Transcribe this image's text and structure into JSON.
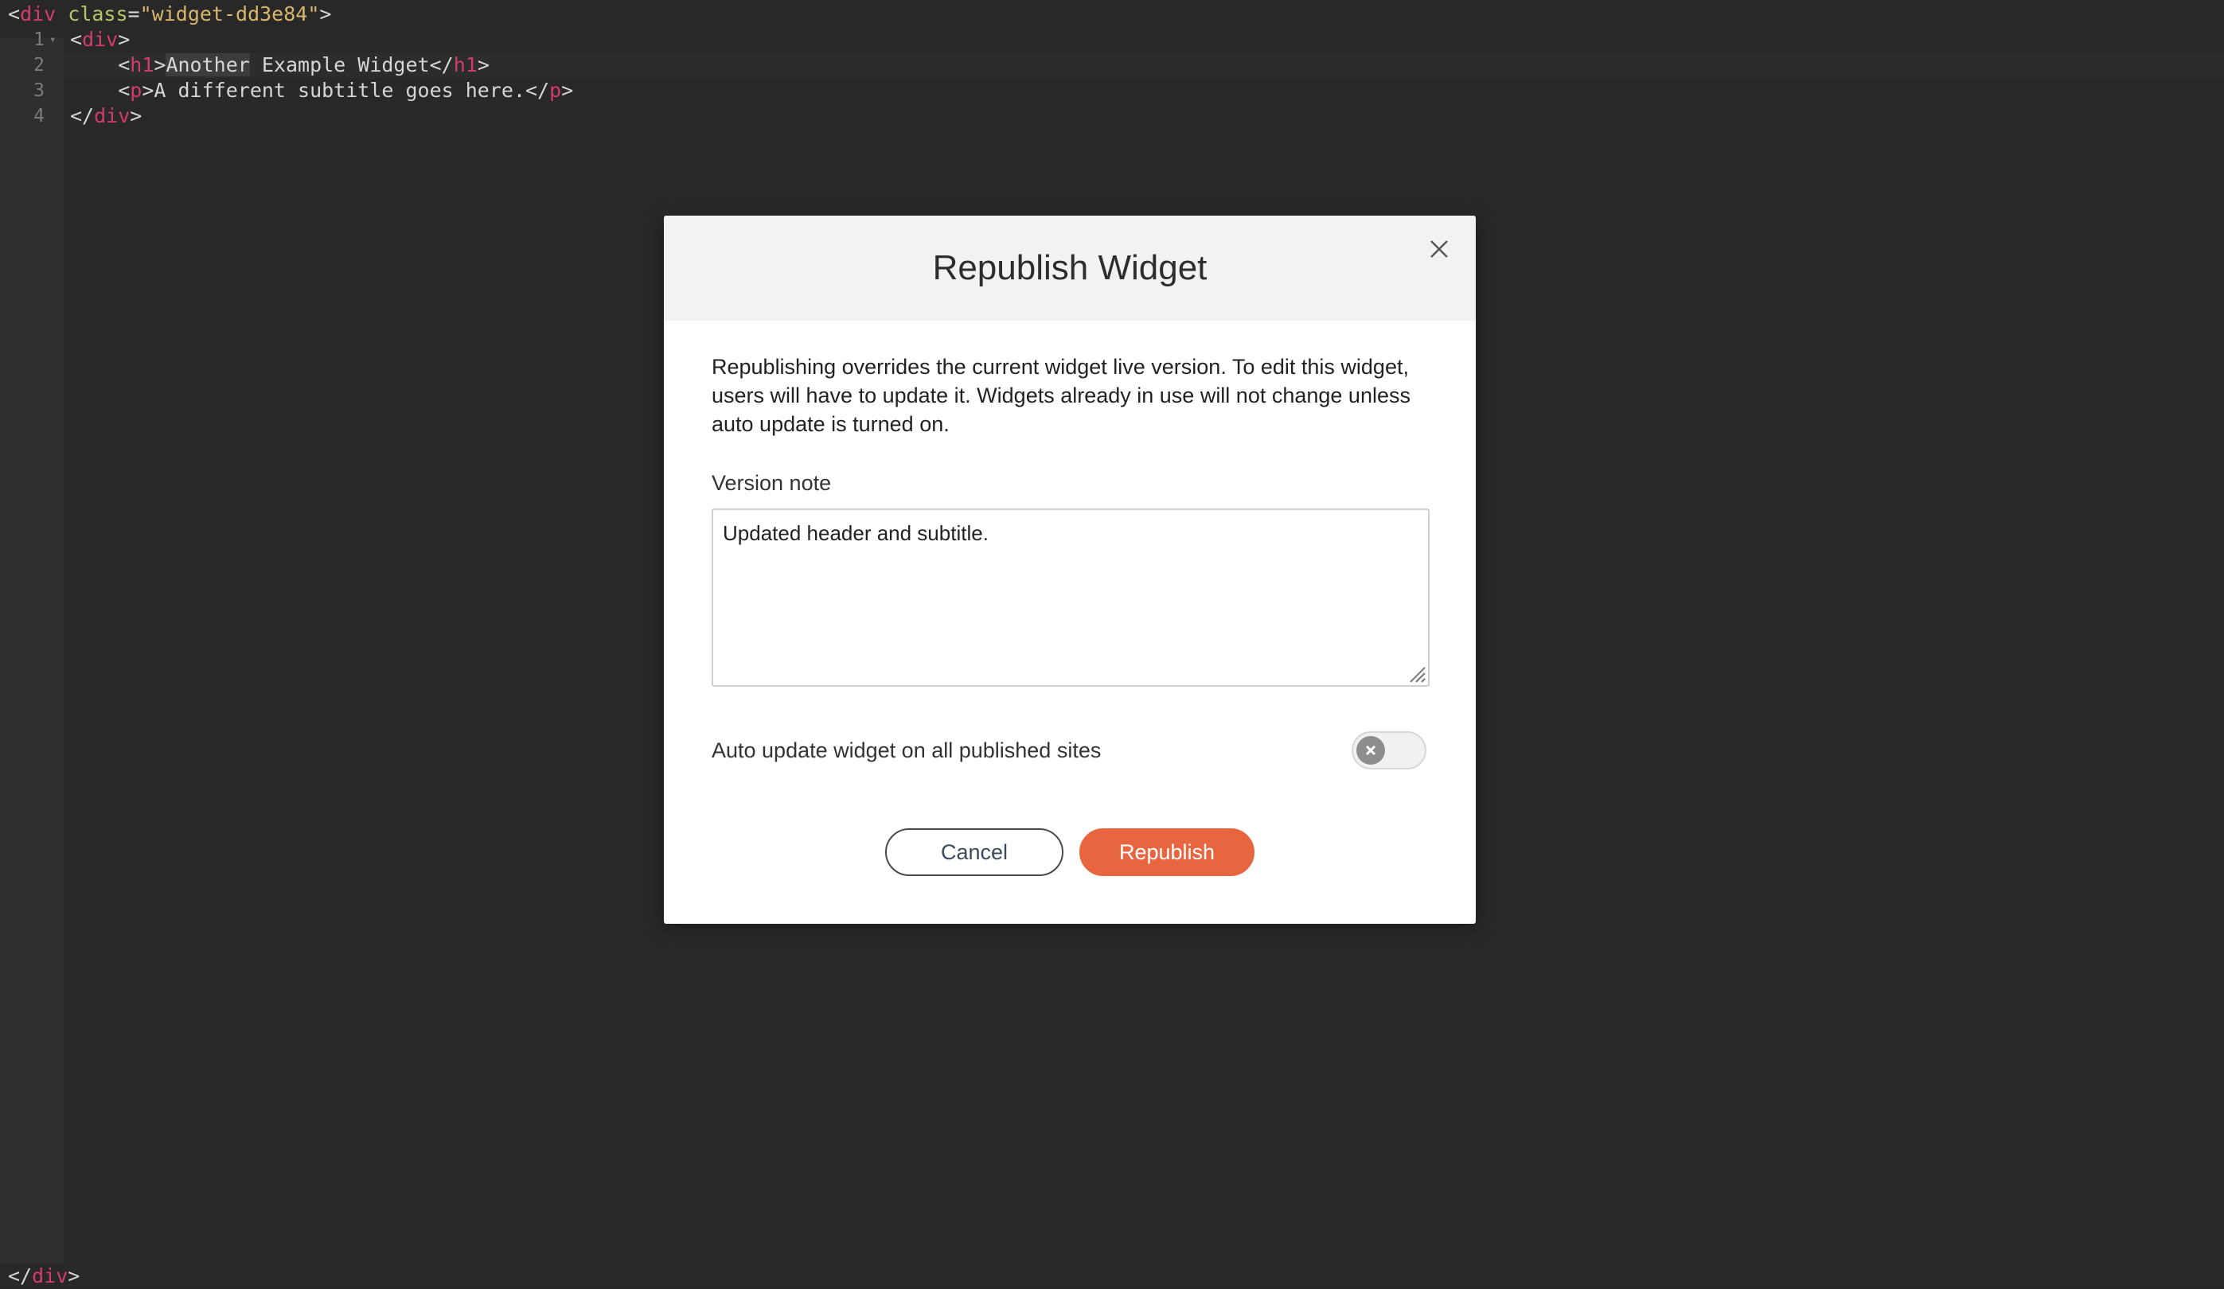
{
  "editor": {
    "wrapper_open": "<div class=\"widget-dd3e84\">",
    "wrapper_open_parts": {
      "lt": "<",
      "tag": "div",
      "attr": "class",
      "eq": "=",
      "str": "\"widget-dd3e84\"",
      "gt": ">"
    },
    "lines": [
      {
        "num": "1",
        "indent": "",
        "open_lt": "<",
        "open_tag": "div",
        "open_gt": ">",
        "text": "",
        "close_lt": "",
        "close_tag": "",
        "close_gt": ""
      },
      {
        "num": "2",
        "indent": "    ",
        "open_lt": "<",
        "open_tag": "h1",
        "open_gt": ">",
        "text_hl": "Another",
        "text": " Example Widget",
        "close_lt": "</",
        "close_tag": "h1",
        "close_gt": ">"
      },
      {
        "num": "3",
        "indent": "    ",
        "open_lt": "<",
        "open_tag": "p",
        "open_gt": ">",
        "text": "A different subtitle goes here.",
        "close_lt": "</",
        "close_tag": "p",
        "close_gt": ">"
      },
      {
        "num": "4",
        "indent": "",
        "open_lt": "</",
        "open_tag": "div",
        "open_gt": ">",
        "text": "",
        "close_lt": "",
        "close_tag": "",
        "close_gt": ""
      }
    ],
    "wrapper_close_parts": {
      "lt": "</",
      "tag": "div",
      "gt": ">"
    }
  },
  "modal": {
    "title": "Republish Widget",
    "description": "Republishing overrides the current widget live version. To edit this widget, users will have to update it. Widgets already in use will not change unless auto update is turned on.",
    "version_note_label": "Version note",
    "version_note_value": "Updated header and subtitle.",
    "auto_update_label": "Auto update widget on all published sites",
    "auto_update_on": false,
    "cancel_label": "Cancel",
    "republish_label": "Republish"
  },
  "colors": {
    "accent": "#e8663f",
    "editor_bg": "#282828",
    "tag": "#d33c68",
    "attr": "#b9c46a",
    "string": "#d8b66c"
  },
  "icons": [
    "close-icon",
    "fold-arrow-icon",
    "toggle-off-icon",
    "resize-grip-icon"
  ]
}
